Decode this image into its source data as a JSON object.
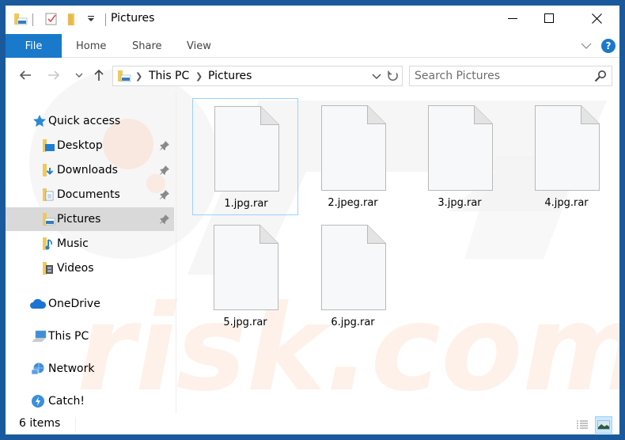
{
  "titlebar": {
    "title": "Pictures",
    "quick_access_toolbar": [
      "folder-pictures-icon",
      "properties-icon",
      "new-folder-icon",
      "customize-dropdown-icon"
    ],
    "controls": {
      "minimize": "minimize",
      "maximize": "maximize",
      "close": "close"
    }
  },
  "ribbon": {
    "tabs": [
      {
        "label": "File",
        "active": true
      },
      {
        "label": "Home"
      },
      {
        "label": "Share"
      },
      {
        "label": "View"
      }
    ],
    "help_label": "?"
  },
  "navbar": {
    "breadcrumb": [
      "This PC",
      "Pictures"
    ],
    "search_placeholder": "Search Pictures"
  },
  "sidebar": {
    "items": [
      {
        "label": "Quick access",
        "icon": "star-icon",
        "level": 0
      },
      {
        "label": "Desktop",
        "icon": "desktop-folder-icon",
        "level": 1,
        "pinned": true
      },
      {
        "label": "Downloads",
        "icon": "downloads-folder-icon",
        "level": 1,
        "pinned": true
      },
      {
        "label": "Documents",
        "icon": "documents-folder-icon",
        "level": 1,
        "pinned": true
      },
      {
        "label": "Pictures",
        "icon": "pictures-folder-icon",
        "level": 1,
        "pinned": true,
        "selected": true
      },
      {
        "label": "Music",
        "icon": "music-folder-icon",
        "level": 1
      },
      {
        "label": "Videos",
        "icon": "videos-folder-icon",
        "level": 1
      },
      {
        "label": "OneDrive",
        "icon": "onedrive-icon",
        "level": 0
      },
      {
        "label": "This PC",
        "icon": "computer-icon",
        "level": 0
      },
      {
        "label": "Network",
        "icon": "network-icon",
        "level": 0
      },
      {
        "label": "Catch!",
        "icon": "catch-icon",
        "level": 0
      }
    ]
  },
  "files": [
    {
      "name": "1.jpg.rar",
      "focused": true
    },
    {
      "name": "2.jpeg.rar"
    },
    {
      "name": "3.jpg.rar"
    },
    {
      "name": "4.jpg.rar"
    },
    {
      "name": "5.jpg.rar"
    },
    {
      "name": "6.jpg.rar"
    }
  ],
  "statusbar": {
    "item_count": "6 items",
    "views": [
      {
        "name": "details-view"
      },
      {
        "name": "large-icons-view",
        "active": true
      }
    ]
  },
  "colors": {
    "accent": "#1979ca",
    "window_border": "#1a5a9c",
    "selection": "#d9d9d9",
    "focus_border": "#99d1ff"
  }
}
